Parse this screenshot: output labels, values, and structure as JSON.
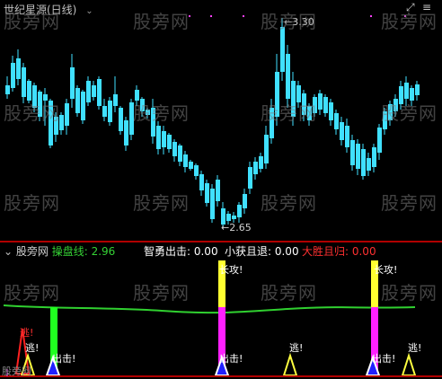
{
  "main": {
    "title": "世纪星源(日线)",
    "high_label": "3.30",
    "low_label": "2.65",
    "watermark": "股旁网"
  },
  "sub": {
    "name": "股旁网",
    "line_label": "操盘线: 2.96",
    "indicators": [
      {
        "label": "智勇出击: 0.00",
        "color": "#ffffff"
      },
      {
        "label": "小获且退: 0.00",
        "color": "#ffffff"
      },
      {
        "label": "大胜且归: 0.00",
        "color": "#ff3030"
      }
    ],
    "signals": {
      "escape": "逃!",
      "attack": "出击!",
      "long_attack": "长攻!"
    },
    "bottom_text": "股旁网"
  },
  "colors": {
    "up": "#ff3030",
    "down": "#40e0ff",
    "line": "#30d030",
    "bar_green": "#20ff20",
    "bar_yellow": "#ffff30",
    "bar_magenta": "#ff20ff"
  },
  "chart_data": {
    "type": "candlestick",
    "high": 3.3,
    "low": 2.65,
    "sub_line": 2.96,
    "signals": [
      "逃!",
      "出击!",
      "长攻!",
      "出击!",
      "逃!",
      "逃!",
      "长攻!",
      "出击!",
      "逃!"
    ]
  }
}
